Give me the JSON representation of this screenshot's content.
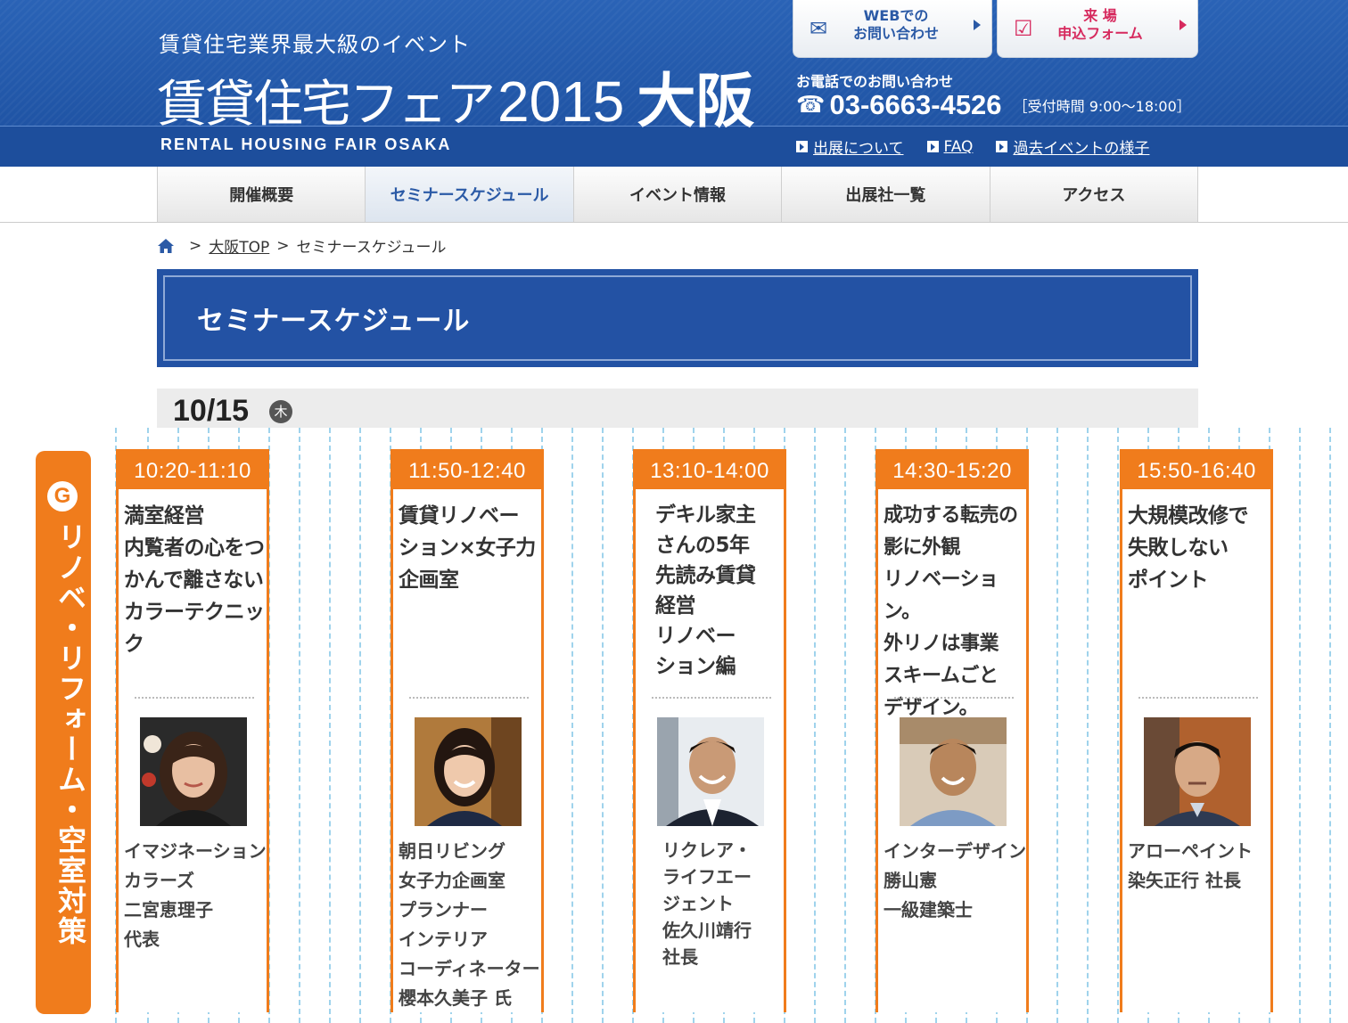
{
  "header": {
    "subtitle": "賃貸住宅業界最大級のイベント",
    "logo_text": "賃貸住宅フェア",
    "logo_year": "2015",
    "logo_city": "大阪",
    "english_title": "RENTAL HOUSING FAIR OSAKA",
    "web_contact_label": "WEBでの\nお問い合わせ",
    "visit_form_label": "来 場\n申込フォーム",
    "tel_label": "お電話でのお問い合わせ",
    "tel_number": "03-6663-4526",
    "tel_hours": "［受付時間 9:00〜18:00］",
    "links": [
      "出展について",
      "FAQ",
      "過去イベントの様子"
    ]
  },
  "nav": {
    "tabs": [
      "開催概要",
      "セミナースケジュール",
      "イベント情報",
      "出展社一覧",
      "アクセス"
    ],
    "active_index": 1
  },
  "breadcrumb": {
    "items": [
      "大阪TOP",
      "セミナースケジュール"
    ]
  },
  "page_title": "セミナースケジュール",
  "date": {
    "date": "10/15",
    "weekday": "木"
  },
  "category": {
    "badge": "G",
    "label": "リノベ・リフォーム・空室対策"
  },
  "seminars": [
    {
      "time": "10:20-11:10",
      "title": "満室経営\n内覧者の心をつ\nかんで離さない\nカラーテクニック",
      "speaker": "イマジネーション\nカラーズ\n二宮恵理子\n代表"
    },
    {
      "time": "11:50-12:40",
      "title": "賃貸リノベー\nション×女子力\n企画室",
      "speaker": "朝日リビング\n女子力企画室\nプランナー\nインテリア\nコーディネーター\n櫻本久美子 氏"
    },
    {
      "time": "13:10-14:00",
      "title": "デキル家主\nさんの5年\n先読み賃貸\n経営\nリノベー\nション編",
      "speaker": "リクレア・\nライフエー\nジェント\n佐久川靖行\n社長"
    },
    {
      "time": "14:30-15:20",
      "title": "成功する転売の\n影に外観\nリノベーション。\n外リノは事業\nスキームごと\nデザイン。",
      "speaker": "インターデザイン\n勝山憲\n一級建築士"
    },
    {
      "time": "15:50-16:40",
      "title": "大規模改修で\n失敗しない\nポイント",
      "speaker": "アローペイント\n染矢正行 社長"
    }
  ],
  "colors": {
    "header_blue": "#1d4e9c",
    "accent_orange": "#f07c1c",
    "grid_line": "#9fd3ec",
    "visit_pink": "#d62a5e"
  }
}
